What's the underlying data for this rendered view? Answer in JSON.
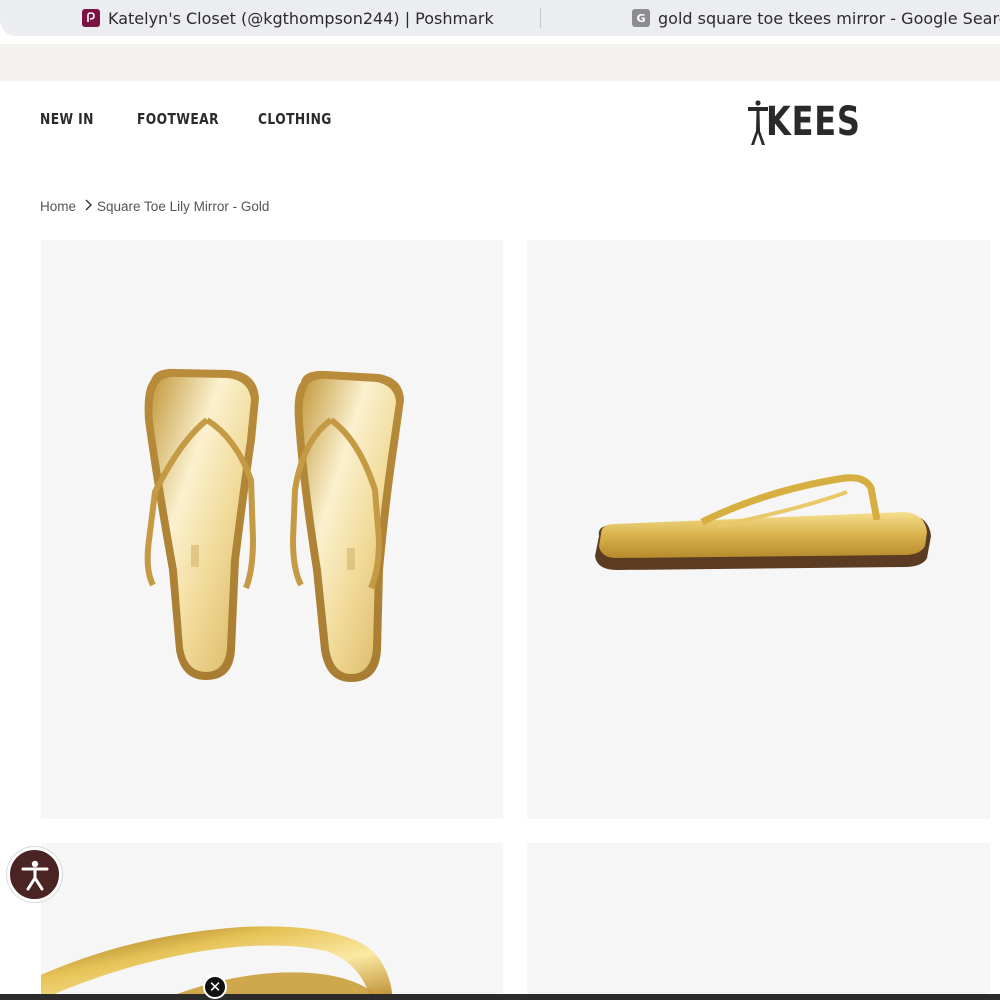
{
  "browser": {
    "tabs": [
      {
        "title": "Katelyn's Closet (@kgthompson244) | Poshmark",
        "icon": "poshmark-favicon"
      },
      {
        "title": "gold square toe tkees mirror - Google Search",
        "icon": "google-favicon",
        "icon_letter": "G"
      }
    ]
  },
  "header": {
    "nav": [
      "NEW IN",
      "FOOTWEAR",
      "CLOTHING"
    ],
    "logo": "KEES"
  },
  "breadcrumb": {
    "home": "Home",
    "current": "Square Toe Lily Mirror - Gold"
  },
  "gallery": {
    "images": [
      {
        "view": "top view of pair"
      },
      {
        "view": "side profile"
      },
      {
        "view": "strap detail close-up"
      },
      {
        "view": "empty"
      }
    ]
  },
  "overlays": {
    "close_glyph": "✕"
  },
  "colors": {
    "gold": "#d2aa4a",
    "nav_text": "#2a2a2a",
    "panel_bg": "#f6f6f6",
    "a11y_bg": "#4a2323"
  }
}
